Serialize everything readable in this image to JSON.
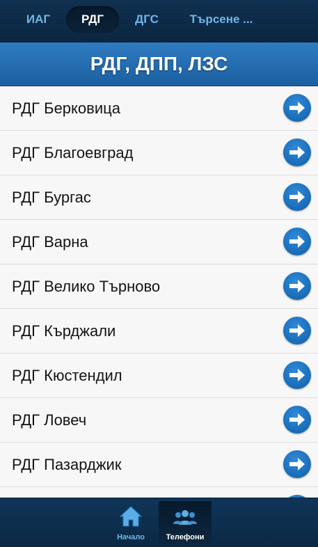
{
  "top_tabs": [
    {
      "label": "ИАГ",
      "active": false
    },
    {
      "label": "РДГ",
      "active": true
    },
    {
      "label": "ДГС",
      "active": false
    },
    {
      "label": "Търсене ...",
      "active": false
    }
  ],
  "header": {
    "title": "РДГ, ДПП, ЛЗС"
  },
  "items": [
    {
      "label": "РДГ Берковица"
    },
    {
      "label": "РДГ Благоевград"
    },
    {
      "label": "РДГ Бургас"
    },
    {
      "label": "РДГ Варна"
    },
    {
      "label": "РДГ Велико Търново"
    },
    {
      "label": "РДГ Кърджали"
    },
    {
      "label": "РДГ Кюстендил"
    },
    {
      "label": "РДГ Ловеч"
    },
    {
      "label": "РДГ Пазарджик"
    },
    {
      "label": ""
    }
  ],
  "footer": {
    "home_label": "Начало",
    "phones_label": "Телефони"
  },
  "colors": {
    "accent": "#1b6fbd",
    "tab_inactive": "#6fb6e8",
    "footer_home_text": "#6fb6e8",
    "footer_active_text": "#ffffff"
  }
}
